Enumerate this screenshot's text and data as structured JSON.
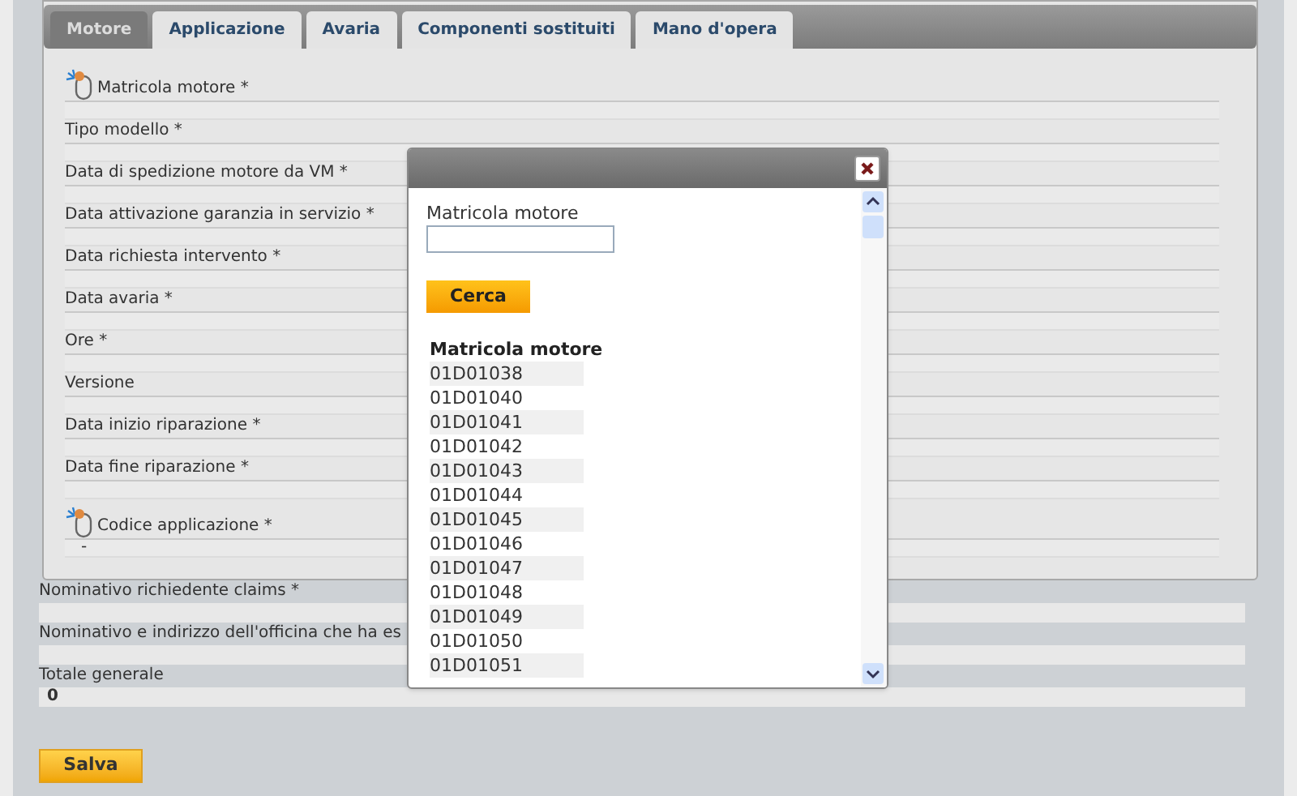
{
  "tabs": [
    {
      "label": "Motore",
      "selected": true
    },
    {
      "label": "Applicazione",
      "selected": false
    },
    {
      "label": "Avaria",
      "selected": false
    },
    {
      "label": "Componenti sostituiti",
      "selected": false
    },
    {
      "label": "Mano d'opera",
      "selected": false
    }
  ],
  "panel_fields": [
    {
      "kind": "lookup",
      "label": "Matricola motore *"
    },
    {
      "kind": "text",
      "label": "Tipo modello *"
    },
    {
      "kind": "text",
      "label": "Data di spedizione motore da VM *"
    },
    {
      "kind": "text",
      "label": "Data attivazione garanzia in servizio *"
    },
    {
      "kind": "text",
      "label": "Data richiesta intervento *"
    },
    {
      "kind": "text",
      "label": "Data avaria *"
    },
    {
      "kind": "text",
      "label": "Ore *"
    },
    {
      "kind": "text",
      "label": "Versione"
    },
    {
      "kind": "text",
      "label": "Data inizio riparazione *"
    },
    {
      "kind": "text",
      "label": "Data fine riparazione *"
    },
    {
      "kind": "lookup",
      "label": "Codice applicazione *",
      "value": "-"
    }
  ],
  "bottom_fields": [
    {
      "label": "Nominativo richiedente claims *"
    },
    {
      "label": "Nominativo e indirizzo dell'officina che ha es"
    },
    {
      "label": "Totale generale",
      "value": "0"
    }
  ],
  "save_button": "Salva",
  "dialog": {
    "field_label": "Matricola motore",
    "search_button": "Cerca",
    "column": "Matricola motore",
    "rows": [
      "01D01038",
      "01D01040",
      "01D01041",
      "01D01042",
      "01D01043",
      "01D01044",
      "01D01045",
      "01D01046",
      "01D01047",
      "01D01048",
      "01D01049",
      "01D01050",
      "01D01051"
    ]
  }
}
